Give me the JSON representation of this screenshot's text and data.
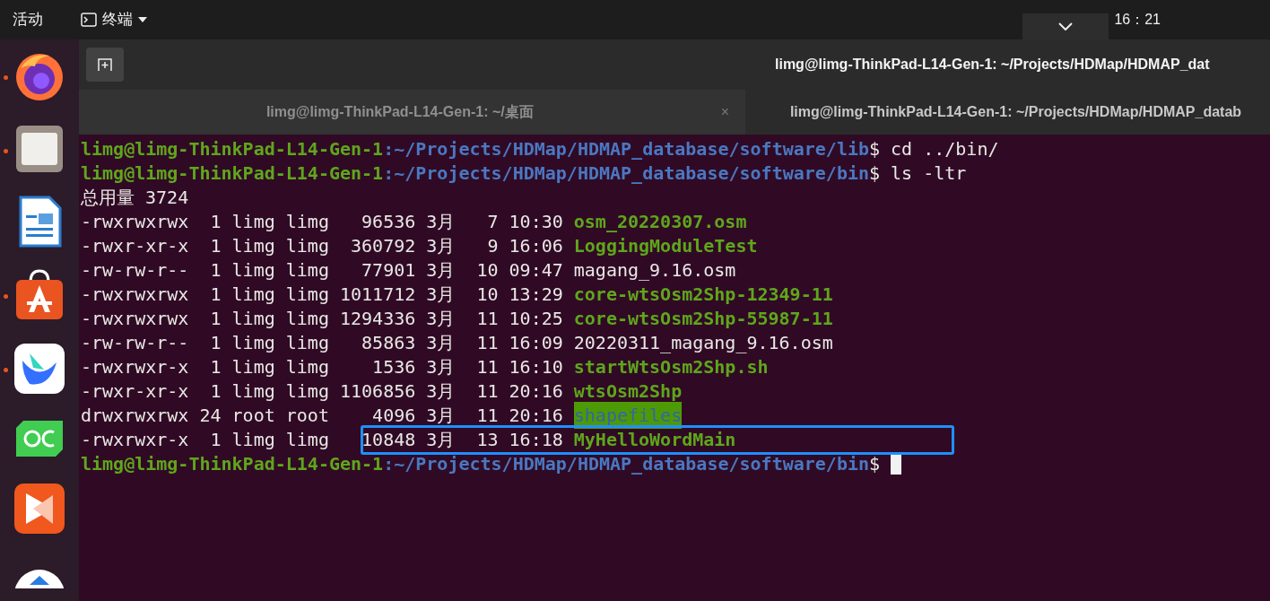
{
  "top_bar": {
    "activities": "活动",
    "app_menu": "终端",
    "clock": "16：21"
  },
  "dock": [
    {
      "kind": "firefox",
      "running": true
    },
    {
      "kind": "files",
      "running": true
    },
    {
      "kind": "writer",
      "running": false
    },
    {
      "kind": "store",
      "running": true
    },
    {
      "kind": "mail",
      "running": true
    },
    {
      "kind": "qc",
      "running": false
    },
    {
      "kind": "share",
      "running": false
    },
    {
      "kind": "partial",
      "running": false
    }
  ],
  "window": {
    "title": "limg@limg-ThinkPad-L14-Gen-1: ~/Projects/HDMap/HDMAP_dat"
  },
  "tabs": [
    {
      "label": "limg@limg-ThinkPad-L14-Gen-1: ~/桌面",
      "selected": false,
      "close": "×"
    },
    {
      "label": "limg@limg-ThinkPad-L14-Gen-1: ~/Projects/HDMap/HDMAP_datab",
      "selected": true
    }
  ],
  "terminal": [
    {
      "kind": "prompt",
      "user": "limg@limg-ThinkPad-L14-Gen-1",
      "path": ":~/Projects/HDMap/HDMAP_database/software/lib",
      "sign": "$",
      "command": "cd ../bin/",
      "cursor": false
    },
    {
      "kind": "prompt",
      "user": "limg@limg-ThinkPad-L14-Gen-1",
      "path": ":~/Projects/HDMap/HDMAP_database/software/bin",
      "sign": "$",
      "command": "ls -ltr",
      "cursor": false
    },
    {
      "kind": "text",
      "text": "总用量 3724"
    },
    {
      "kind": "listing",
      "meta": "-rwxrwxrwx  1 limg limg   96536 3月   7 10:30",
      "name": {
        "text": "osm_20220307.osm",
        "kind": "exec"
      },
      "highlighted": false
    },
    {
      "kind": "listing",
      "meta": "-rwxr-xr-x  1 limg limg  360792 3月   9 16:06",
      "name": {
        "text": "LoggingModuleTest",
        "kind": "exec"
      },
      "highlighted": false
    },
    {
      "kind": "listing",
      "meta": "-rw-rw-r--  1 limg limg   77901 3月  10 09:47",
      "name": {
        "text": "magang_9.16.osm",
        "kind": "plain"
      },
      "highlighted": false
    },
    {
      "kind": "listing",
      "meta": "-rwxrwxrwx  1 limg limg 1011712 3月  10 13:29",
      "name": {
        "text": "core-wtsOsm2Shp-12349-11",
        "kind": "exec"
      },
      "highlighted": false
    },
    {
      "kind": "listing",
      "meta": "-rwxrwxrwx  1 limg limg 1294336 3月  11 10:25",
      "name": {
        "text": "core-wtsOsm2Shp-55987-11",
        "kind": "exec"
      },
      "highlighted": false
    },
    {
      "kind": "listing",
      "meta": "-rw-rw-r--  1 limg limg   85863 3月  11 16:09",
      "name": {
        "text": "20220311_magang_9.16.osm",
        "kind": "plain"
      },
      "highlighted": false
    },
    {
      "kind": "listing",
      "meta": "-rwxrwxr-x  1 limg limg    1536 3月  11 16:10",
      "name": {
        "text": "startWtsOsm2Shp.sh",
        "kind": "exec"
      },
      "highlighted": false
    },
    {
      "kind": "listing",
      "meta": "-rwxr-xr-x  1 limg limg 1106856 3月  11 20:16",
      "name": {
        "text": "wtsOsm2Shp",
        "kind": "exec"
      },
      "highlighted": false
    },
    {
      "kind": "listing",
      "meta": "drwxrwxrwx 24 root root    4096 3月  11 20:16",
      "name": {
        "text": "shapefiles",
        "kind": "dir"
      },
      "highlighted": false
    },
    {
      "kind": "listing",
      "meta": "-rwxrwxr-x  1 limg limg   10848 3月  13 16:18",
      "name": {
        "text": "MyHelloWordMain",
        "kind": "exec"
      },
      "highlighted": true
    },
    {
      "kind": "prompt",
      "user": "limg@limg-ThinkPad-L14-Gen-1",
      "path": ":~/Projects/HDMap/HDMAP_database/software/bin",
      "sign": "$",
      "cursor": true
    }
  ]
}
